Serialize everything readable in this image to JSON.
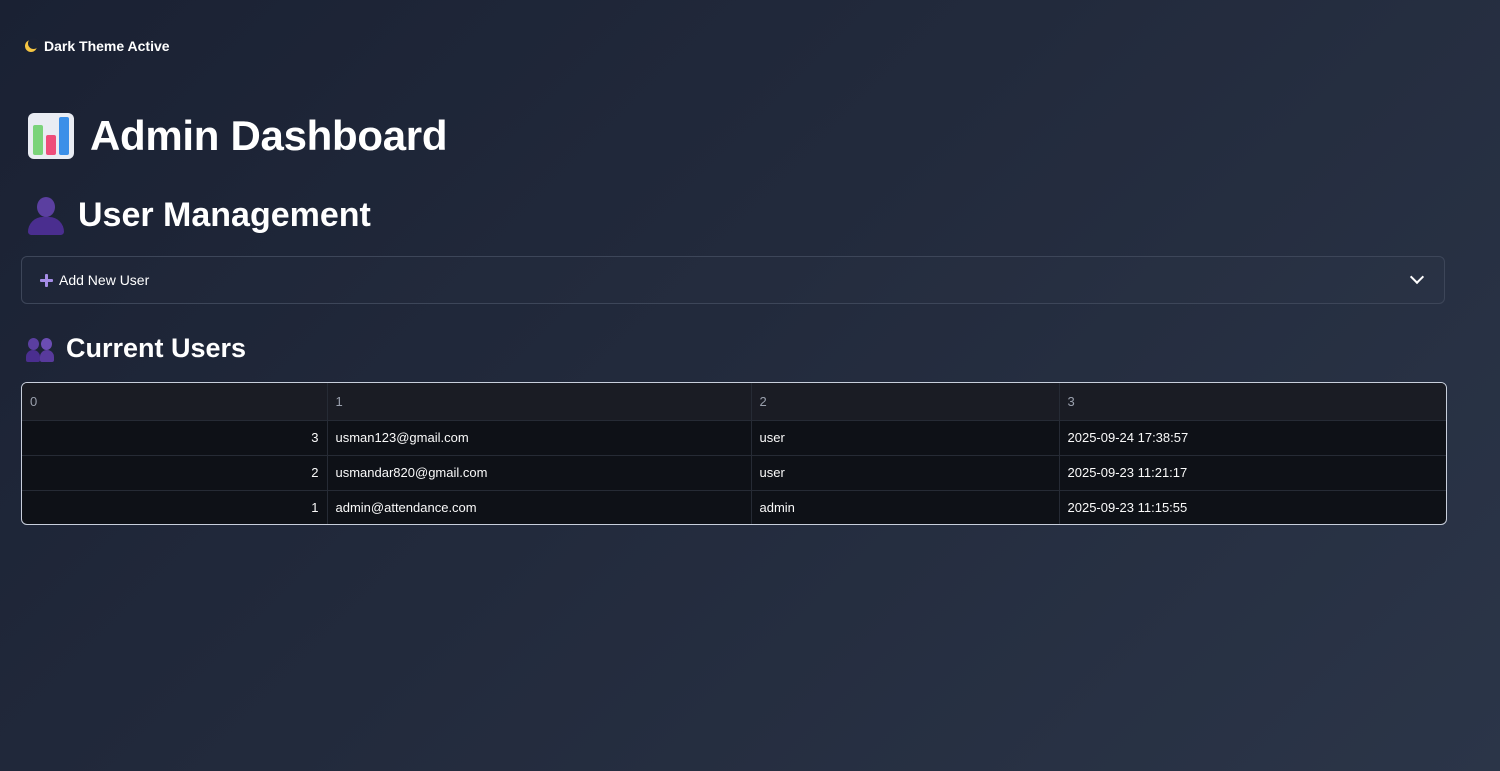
{
  "theme": {
    "indicator_label": "Dark Theme Active"
  },
  "page": {
    "title": "Admin Dashboard"
  },
  "user_management": {
    "title": "User Management",
    "expander_label": "Add New User"
  },
  "current_users": {
    "title": "Current Users",
    "columns": [
      "0",
      "1",
      "2",
      "3"
    ],
    "rows": [
      {
        "id": "3",
        "email": "usman123@gmail.com",
        "role": "user",
        "created": "2025-09-24 17:38:57"
      },
      {
        "id": "2",
        "email": "usmandar820@gmail.com",
        "role": "user",
        "created": "2025-09-23 11:21:17"
      },
      {
        "id": "1",
        "email": "admin@attendance.com",
        "role": "admin",
        "created": "2025-09-23 11:15:55"
      }
    ]
  },
  "icons": {
    "theme": "moon-icon",
    "page": "bar-chart-icon",
    "user_management": "user-icon",
    "expander": "plus-icon",
    "expander_toggle": "chevron-down-icon",
    "current_users": "users-icon"
  },
  "colors": {
    "accent": "#a58de6",
    "background": "#1f2638",
    "table_bg": "#0e1117"
  }
}
